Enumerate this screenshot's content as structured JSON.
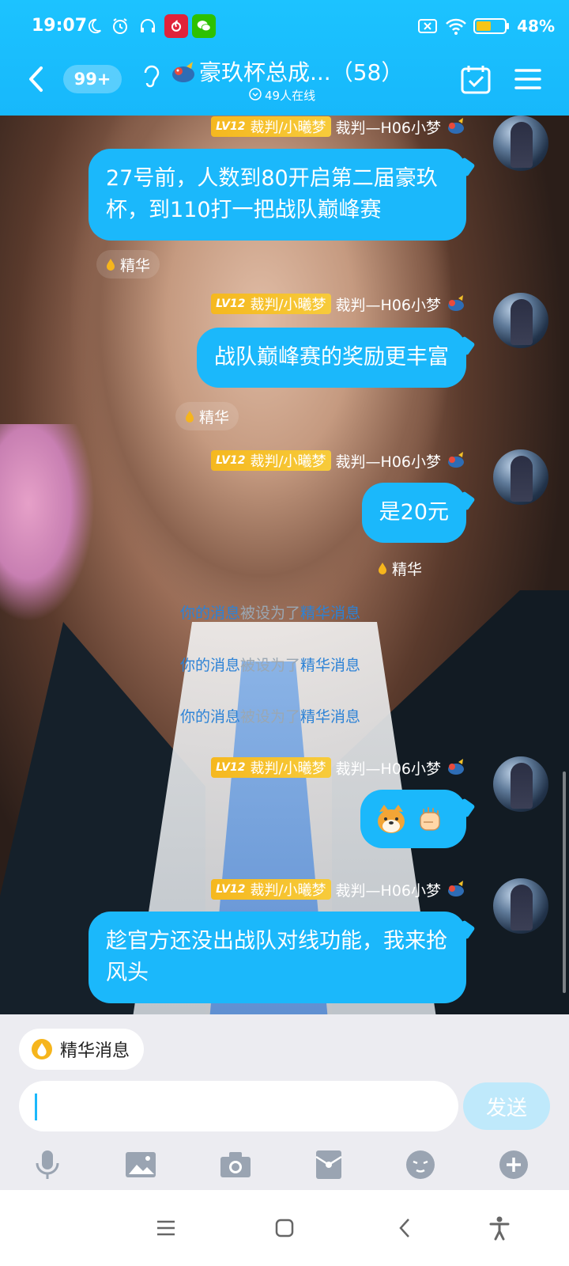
{
  "status_bar": {
    "time": "19:07",
    "battery": "48%",
    "icons": [
      "moon-icon",
      "alarm-icon",
      "headset-icon",
      "netease-music-icon",
      "wechat-icon",
      "sim-off-icon",
      "wifi-icon",
      "battery-icon"
    ]
  },
  "header": {
    "badge": "99+",
    "title": "豪玖杯总成...（58）",
    "online": "49人在线",
    "accent": "#1bb8fb"
  },
  "messages": [
    {
      "level": "LV12",
      "role": "裁判/小曦梦",
      "sender": "裁判—H06小梦",
      "text": "27号前，人数到80开启第二届豪玖杯，到110打一把战队巅峰赛",
      "essence": "精华"
    },
    {
      "level": "LV12",
      "role": "裁判/小曦梦",
      "sender": "裁判—H06小梦",
      "text": "战队巅峰赛的奖励更丰富",
      "essence": "精华"
    },
    {
      "level": "LV12",
      "role": "裁判/小曦梦",
      "sender": "裁判—H06小梦",
      "text": "是20元",
      "essence": "精华"
    },
    {
      "level": "LV12",
      "role": "裁判/小曦梦",
      "sender": "裁判—H06小梦",
      "emojis": [
        "shiba-dog-emoji",
        "fist-emoji"
      ]
    },
    {
      "level": "LV12",
      "role": "裁判/小曦梦",
      "sender": "裁判—H06小梦",
      "text": "趁官方还没出战队对线功能，我来抢风头"
    }
  ],
  "system_notices": [
    {
      "part1": "你的消息",
      "part2": "被设为了",
      "part3": "精华消息"
    },
    {
      "part1": "你的消息",
      "part2": "被设为了",
      "part3": "精华消息"
    },
    {
      "part1": "你的消息",
      "part2": "被设为了",
      "part3": "精华消息"
    }
  ],
  "input_area": {
    "chip_label": "精华消息",
    "input_value": "",
    "send_label": "发送",
    "toolbar": [
      "microphone-icon",
      "image-icon",
      "camera-icon",
      "red-packet-icon",
      "emoji-icon",
      "plus-icon"
    ]
  },
  "nav_bar": [
    "menu-icon",
    "home-icon",
    "back-icon",
    "accessibility-icon"
  ]
}
